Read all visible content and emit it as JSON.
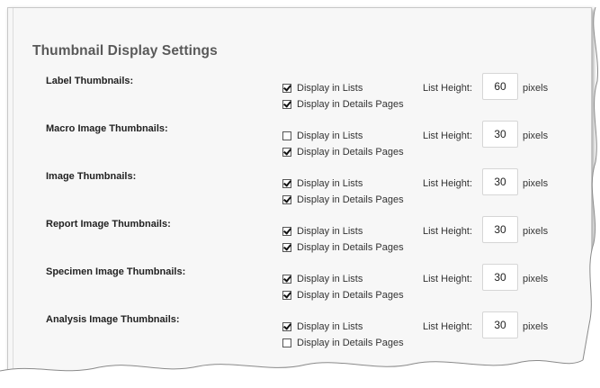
{
  "section": {
    "title": "Thumbnail Display Settings"
  },
  "labels": {
    "display_in_lists": "Display in Lists",
    "display_in_details": "Display in Details Pages",
    "list_height": "List Height:",
    "pixels": "pixels"
  },
  "rows": [
    {
      "label": "Label Thumbnails:",
      "lists_checked": true,
      "details_checked": true,
      "height": "60"
    },
    {
      "label": "Macro Image Thumbnails:",
      "lists_checked": false,
      "details_checked": true,
      "height": "30"
    },
    {
      "label": "Image Thumbnails:",
      "lists_checked": true,
      "details_checked": true,
      "height": "30"
    },
    {
      "label": "Report Image Thumbnails:",
      "lists_checked": true,
      "details_checked": true,
      "height": "30"
    },
    {
      "label": "Specimen Image Thumbnails:",
      "lists_checked": true,
      "details_checked": true,
      "height": "30"
    },
    {
      "label": "Analysis Image Thumbnails:",
      "lists_checked": true,
      "details_checked": false,
      "height": "30"
    }
  ]
}
